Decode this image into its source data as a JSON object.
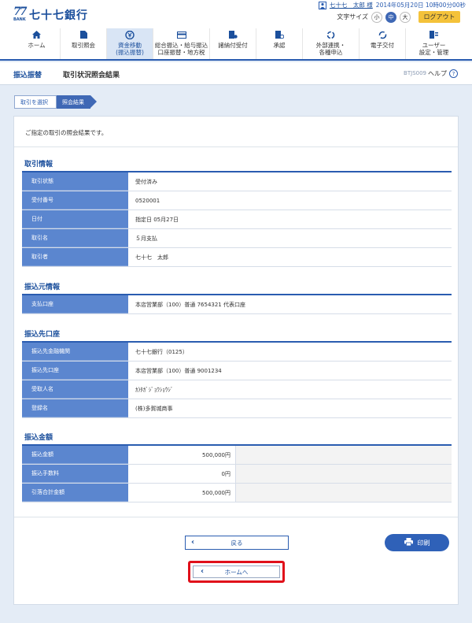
{
  "brand": {
    "mark": "77",
    "mark_sub": "BANK",
    "name": "七十七銀行"
  },
  "user": {
    "icon": "user-badge-icon",
    "name": "七十七　太郎 様",
    "datetime": "2014年05月20日 10時00分00秒"
  },
  "font_size": {
    "label": "文字サイズ",
    "small": "小",
    "medium": "中",
    "large": "大",
    "selected": "中"
  },
  "logout_label": "ログアウト",
  "nav": [
    {
      "label": "ホーム",
      "icon": "home-icon"
    },
    {
      "label": "取引照会",
      "icon": "document-icon"
    },
    {
      "label": "資金移動\n(振込振替)",
      "icon": "yen-transfer-icon",
      "active": true
    },
    {
      "label": "総合振込・給与振込\n口座振替・地方税",
      "icon": "card-icon"
    },
    {
      "label": "諸納付受付",
      "icon": "payment-icon"
    },
    {
      "label": "承認",
      "icon": "approval-icon"
    },
    {
      "label": "外部連携・\n各種申込",
      "icon": "link-icon"
    },
    {
      "label": "電子交付",
      "icon": "refresh-icon"
    },
    {
      "label": "ユーザー\n設定・管理",
      "icon": "user-settings-icon"
    }
  ],
  "titlebar": {
    "section": "振込振替",
    "title": "取引状況照会結果",
    "code": "BTJS009",
    "help": "ヘルプ"
  },
  "steps": [
    "取引を選択",
    "照会結果"
  ],
  "intro": "ご指定の取引の照会結果です。",
  "sections": {
    "transaction": {
      "title": "取引情報",
      "rows": [
        {
          "label": "取引状態",
          "value": "受付済み"
        },
        {
          "label": "受付番号",
          "value": "0520001"
        },
        {
          "label": "日付",
          "value": "指定日 05月27日"
        },
        {
          "label": "取引名",
          "value": "５月支払"
        },
        {
          "label": "取引者",
          "value": "七十七　太郎"
        }
      ]
    },
    "source": {
      "title": "振込元情報",
      "rows": [
        {
          "label": "支払口座",
          "value": "本店営業部（100）普通 7654321 代表口座"
        }
      ]
    },
    "destination": {
      "title": "振込先口座",
      "rows": [
        {
          "label": "振込先金融機関",
          "value": "七十七銀行（0125）"
        },
        {
          "label": "振込先口座",
          "value": "本店営業部（100）普通 9001234"
        },
        {
          "label": "受取人名",
          "value": "ｶ)ﾀｶﾞｼﾞｮｳｼｮｳｼﾞ"
        },
        {
          "label": "登録名",
          "value": "(株)多賀城商事"
        }
      ]
    },
    "amount": {
      "title": "振込金額",
      "rows": [
        {
          "label": "振込金額",
          "value": "500,000円"
        },
        {
          "label": "振込手数料",
          "value": "0円"
        },
        {
          "label": "引落合計金額",
          "value": "500,000円"
        }
      ]
    }
  },
  "buttons": {
    "back": "戻る",
    "print": "印刷",
    "home": "ホームへ"
  },
  "colors": {
    "primary": "#2a5cb0",
    "label_bg": "#5b86cf",
    "accent": "#f4c23a",
    "highlight": "#e0101a"
  }
}
